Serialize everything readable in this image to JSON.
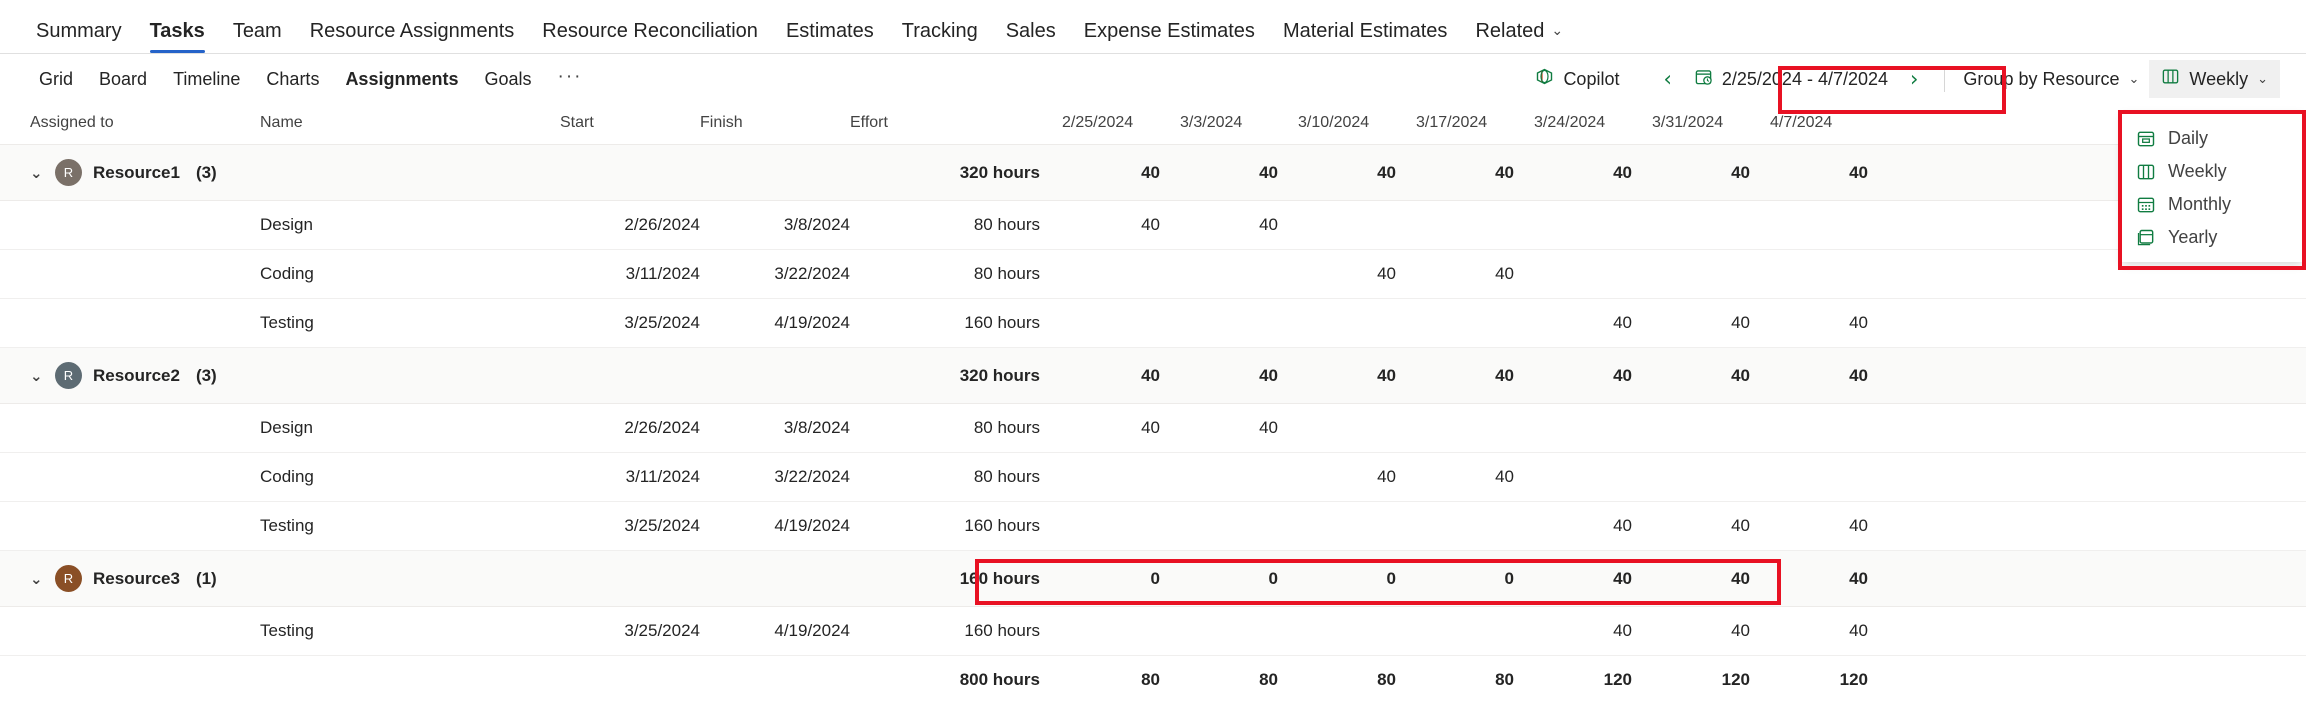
{
  "top_nav": {
    "tabs": [
      {
        "label": "Summary",
        "active": false
      },
      {
        "label": "Tasks",
        "active": true
      },
      {
        "label": "Team",
        "active": false
      },
      {
        "label": "Resource Assignments",
        "active": false
      },
      {
        "label": "Resource Reconciliation",
        "active": false
      },
      {
        "label": "Estimates",
        "active": false
      },
      {
        "label": "Tracking",
        "active": false
      },
      {
        "label": "Sales",
        "active": false
      },
      {
        "label": "Expense Estimates",
        "active": false
      },
      {
        "label": "Material Estimates",
        "active": false
      },
      {
        "label": "Related",
        "active": false,
        "chevron": "⌄"
      }
    ]
  },
  "sub_nav": {
    "tabs": [
      {
        "label": "Grid",
        "active": false
      },
      {
        "label": "Board",
        "active": false
      },
      {
        "label": "Timeline",
        "active": false
      },
      {
        "label": "Charts",
        "active": false
      },
      {
        "label": "Assignments",
        "active": true
      },
      {
        "label": "Goals",
        "active": false
      }
    ],
    "overflow_label": "···"
  },
  "toolbar": {
    "copilot_label": "Copilot",
    "prev_arrow": "‹",
    "next_arrow": "›",
    "date_range": "2/25/2024 - 4/7/2024",
    "group_by_label": "Group by Resource",
    "scale_label": "Weekly",
    "chevron": "⌄"
  },
  "scale_menu": {
    "items": [
      {
        "label": "Daily",
        "icon": "daily-icon"
      },
      {
        "label": "Weekly",
        "icon": "weekly-icon"
      },
      {
        "label": "Monthly",
        "icon": "monthly-icon"
      },
      {
        "label": "Yearly",
        "icon": "yearly-icon"
      }
    ]
  },
  "table": {
    "headers": {
      "assigned_to": "Assigned to",
      "name": "Name",
      "start": "Start",
      "finish": "Finish",
      "effort": "Effort"
    },
    "period_headers": [
      "2/25/2024",
      "3/3/2024",
      "3/10/2024",
      "3/17/2024",
      "3/24/2024",
      "3/31/2024",
      "4/7/2024"
    ],
    "groups": [
      {
        "name": "Resource1",
        "count": "(3)",
        "avatar_initial": "R",
        "avatar_color": "#7a7068",
        "caret": "⌄",
        "effort": "320 hours",
        "periods": [
          "40",
          "40",
          "40",
          "40",
          "40",
          "40",
          "40"
        ],
        "rows": [
          {
            "name": "Design",
            "start": "2/26/2024",
            "finish": "3/8/2024",
            "effort": "80 hours",
            "periods": [
              "40",
              "40",
              "",
              "",
              "",
              "",
              ""
            ]
          },
          {
            "name": "Coding",
            "start": "3/11/2024",
            "finish": "3/22/2024",
            "effort": "80 hours",
            "periods": [
              "",
              "",
              "40",
              "40",
              "",
              "",
              ""
            ]
          },
          {
            "name": "Testing",
            "start": "3/25/2024",
            "finish": "4/19/2024",
            "effort": "160 hours",
            "periods": [
              "",
              "",
              "",
              "",
              "40",
              "40",
              "40"
            ]
          }
        ]
      },
      {
        "name": "Resource2",
        "count": "(3)",
        "avatar_initial": "R",
        "avatar_color": "#5d6b73",
        "caret": "⌄",
        "effort": "320 hours",
        "periods": [
          "40",
          "40",
          "40",
          "40",
          "40",
          "40",
          "40"
        ],
        "rows": [
          {
            "name": "Design",
            "start": "2/26/2024",
            "finish": "3/8/2024",
            "effort": "80 hours",
            "periods": [
              "40",
              "40",
              "",
              "",
              "",
              "",
              ""
            ]
          },
          {
            "name": "Coding",
            "start": "3/11/2024",
            "finish": "3/22/2024",
            "effort": "80 hours",
            "periods": [
              "",
              "",
              "40",
              "40",
              "",
              "",
              ""
            ]
          },
          {
            "name": "Testing",
            "start": "3/25/2024",
            "finish": "4/19/2024",
            "effort": "160 hours",
            "periods": [
              "",
              "",
              "",
              "",
              "40",
              "40",
              "40"
            ]
          }
        ]
      },
      {
        "name": "Resource3",
        "count": "(1)",
        "avatar_initial": "R",
        "avatar_color": "#8a4f26",
        "caret": "⌄",
        "effort": "160 hours",
        "periods": [
          "0",
          "0",
          "0",
          "0",
          "40",
          "40",
          "40"
        ],
        "rows": [
          {
            "name": "Testing",
            "start": "3/25/2024",
            "finish": "4/19/2024",
            "effort": "160 hours",
            "periods": [
              "",
              "",
              "",
              "",
              "40",
              "40",
              "40"
            ]
          }
        ]
      }
    ],
    "total": {
      "effort": "800 hours",
      "periods": [
        "80",
        "80",
        "80",
        "80",
        "120",
        "120",
        "120"
      ]
    }
  },
  "colors": {
    "accent_blue": "#2563c9",
    "highlight_red": "#e81123",
    "green": "#107c41"
  }
}
